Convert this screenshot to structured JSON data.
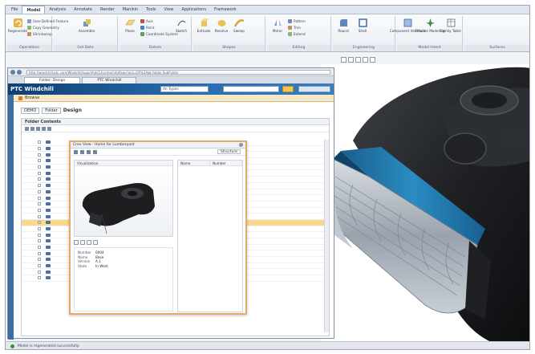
{
  "ribbon": {
    "tabs": [
      "File",
      "Model",
      "Analysis",
      "Annotate",
      "Render",
      "Manikin",
      "Tools",
      "View",
      "Applications",
      "Framework"
    ],
    "active_tab": "Model",
    "groups": [
      "Operations",
      "Get Data",
      "Datum",
      "Shapes",
      "Editing",
      "Engineering",
      "Model Intent",
      "Surfaces"
    ],
    "buttons": [
      "Regenerate",
      "Assemble",
      "Plane",
      "Sketch",
      "Extrude",
      "Revolve",
      "Sweep",
      "Mirror",
      "Round",
      "Shell",
      "Component Interface",
      "Flexible Modeling",
      "Family Table"
    ],
    "small_items": [
      "User-Defined Feature",
      "Copy Geometry",
      "Shrinkwrap",
      "Axis",
      "Point",
      "Coordinate System",
      "Pattern",
      "Trim",
      "Extend"
    ]
  },
  "browser": {
    "url": "http://windchill.ptc.com/Windchill/app/#ptc1/tcomp/infoPage?oid=OR%3Awt.folder.SubFolder",
    "tabs": [
      "Folder: Design",
      "PTC Windchill"
    ],
    "logo": "PTC Windchill",
    "search_type": "All Types",
    "browse_label": "Browse",
    "breadcrumb": [
      "DEMO",
      "Folder"
    ],
    "folder_title": "Design",
    "panel_title": "Folder Contents",
    "row_count": 23,
    "highlighted_row": 13
  },
  "popup": {
    "title": "Creo View - Home for Lumberyard",
    "thumbnail_header": "Visualization",
    "select_label": "Structure",
    "columns": [
      "Name",
      "Number"
    ],
    "properties": [
      {
        "k": "Number",
        "v": "0004"
      },
      {
        "k": "Name",
        "v": "Base"
      },
      {
        "k": "Version",
        "v": "A.1"
      },
      {
        "k": "State",
        "v": "In Work"
      }
    ]
  },
  "status": {
    "text": "Model is regenerated successfully."
  },
  "colors": {
    "ptc_blue": "#1e5a98",
    "highlight": "#f9d98a",
    "popup_border": "#e8a968",
    "shaver_blue": "#1f78a8"
  }
}
